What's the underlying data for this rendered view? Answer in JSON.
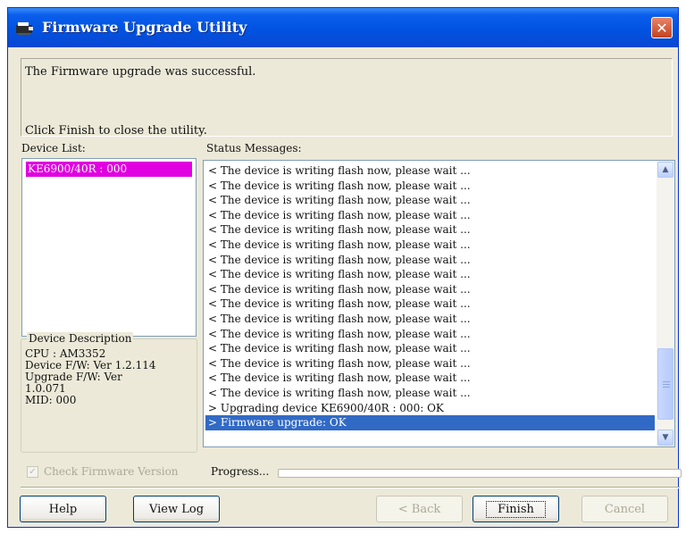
{
  "window": {
    "title": "Firmware Upgrade Utility",
    "close_glyph": "✕",
    "icon": "firmware-app-icon"
  },
  "messages": {
    "success": "The Firmware upgrade was successful.",
    "hint": "Click Finish to close the utility."
  },
  "device_list": {
    "label": "Device List:",
    "items": [
      "KE6900/40R : 000"
    ]
  },
  "device_description": {
    "title": "Device Description",
    "lines": [
      "CPU : AM3352",
      "Device F/W: Ver 1.2.114",
      "Upgrade F/W: Ver",
      "1.0.071",
      "MID: 000"
    ]
  },
  "status": {
    "label": "Status Messages:",
    "lines": [
      "< The device is writing flash now, please wait ...",
      "< The device is writing flash now, please wait ...",
      "< The device is writing flash now, please wait ...",
      "< The device is writing flash now, please wait ...",
      "< The device is writing flash now, please wait ...",
      "< The device is writing flash now, please wait ...",
      "< The device is writing flash now, please wait ...",
      "< The device is writing flash now, please wait ...",
      "< The device is writing flash now, please wait ...",
      "< The device is writing flash now, please wait ...",
      "< The device is writing flash now, please wait ...",
      "< The device is writing flash now, please wait ...",
      "< The device is writing flash now, please wait ...",
      "< The device is writing flash now, please wait ...",
      "< The device is writing flash now, please wait ...",
      "< The device is writing flash now, please wait ...",
      "> Upgrading device KE6900/40R : 000: OK",
      "> Firmware upgrade: OK"
    ],
    "selected_index": 17,
    "scroll_up_glyph": "▲",
    "scroll_down_glyph": "▼"
  },
  "check_firmware": {
    "label": "Check Firmware Version",
    "checked": true,
    "enabled": false,
    "glyph": "✓"
  },
  "progress": {
    "label": "Progress...",
    "value": 0
  },
  "buttons": {
    "help": "Help",
    "view_log": "View Log",
    "back": "< Back",
    "finish": "Finish",
    "cancel": "Cancel"
  },
  "colors": {
    "title_bar": "#0053E1",
    "selection": "#316AC5",
    "device_highlight": "#E000E0",
    "face": "#ECE9D8"
  }
}
